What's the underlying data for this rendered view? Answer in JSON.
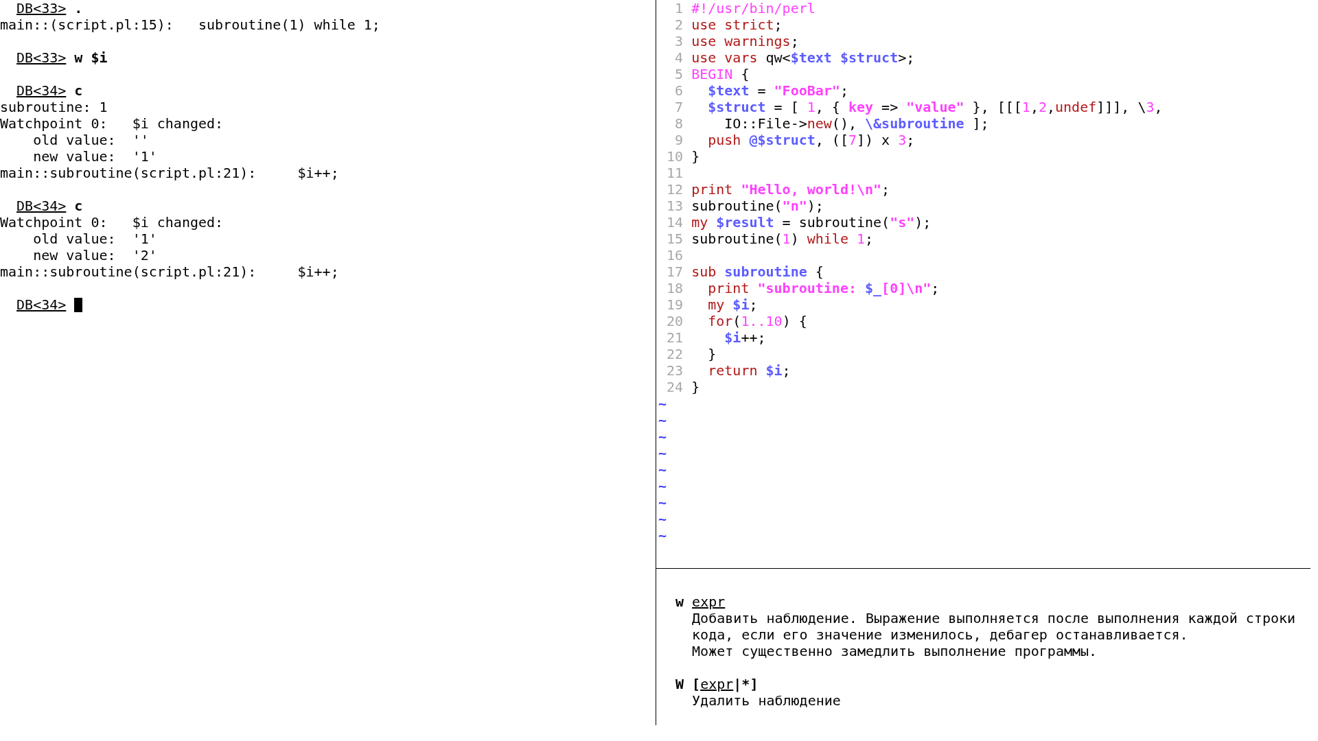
{
  "terminal": {
    "lines": [
      {
        "kind": "prompt",
        "prompt": "DB<33>",
        "command": ".",
        "cursor": false
      },
      {
        "kind": "output",
        "text": "main::(script.pl:15):   subroutine(1) while 1;"
      },
      {
        "kind": "blank"
      },
      {
        "kind": "prompt",
        "prompt": "DB<33>",
        "command": "w $i",
        "cursor": false
      },
      {
        "kind": "blank"
      },
      {
        "kind": "prompt",
        "prompt": "DB<34>",
        "command": "c",
        "cursor": false
      },
      {
        "kind": "output",
        "text": "subroutine: 1"
      },
      {
        "kind": "output",
        "text": "Watchpoint 0:   $i changed:"
      },
      {
        "kind": "output",
        "text": "    old value:  ''"
      },
      {
        "kind": "output",
        "text": "    new value:  '1'"
      },
      {
        "kind": "output",
        "text": "main::subroutine(script.pl:21):     $i++;"
      },
      {
        "kind": "blank"
      },
      {
        "kind": "prompt",
        "prompt": "DB<34>",
        "command": "c",
        "cursor": false
      },
      {
        "kind": "output",
        "text": "Watchpoint 0:   $i changed:"
      },
      {
        "kind": "output",
        "text": "    old value:  '1'"
      },
      {
        "kind": "output",
        "text": "    new value:  '2'"
      },
      {
        "kind": "output",
        "text": "main::subroutine(script.pl:21):     $i++;"
      },
      {
        "kind": "blank"
      },
      {
        "kind": "prompt",
        "prompt": "DB<34>",
        "cursor": true
      }
    ]
  },
  "editor": {
    "lines": [
      {
        "number": "1",
        "tokens": [
          {
            "kind": "pre",
            "text": "#!/usr/bin/perl"
          }
        ]
      },
      {
        "number": "2",
        "tokens": [
          {
            "kind": "stmt",
            "text": "use strict"
          },
          {
            "kind": "plain",
            "text": ";"
          }
        ]
      },
      {
        "number": "3",
        "tokens": [
          {
            "kind": "stmt",
            "text": "use warnings"
          },
          {
            "kind": "plain",
            "text": ";"
          }
        ]
      },
      {
        "number": "4",
        "tokens": [
          {
            "kind": "stmt",
            "text": "use vars "
          },
          {
            "kind": "plain",
            "text": "qw<"
          },
          {
            "kind": "var",
            "text": "$text $struct"
          },
          {
            "kind": "plain",
            "text": ">;"
          }
        ]
      },
      {
        "number": "5",
        "tokens": [
          {
            "kind": "pre",
            "text": "BEGIN"
          },
          {
            "kind": "plain",
            "text": " {"
          }
        ]
      },
      {
        "number": "6",
        "tokens": [
          {
            "kind": "var",
            "text": "  $text"
          },
          {
            "kind": "plain",
            "text": " = "
          },
          {
            "kind": "str",
            "text": "\"FooBar\""
          },
          {
            "kind": "plain",
            "text": ";"
          }
        ]
      },
      {
        "number": "7",
        "tokens": [
          {
            "kind": "var",
            "text": "  $struct"
          },
          {
            "kind": "plain",
            "text": " = [ "
          },
          {
            "kind": "num",
            "text": "1"
          },
          {
            "kind": "plain",
            "text": ", { "
          },
          {
            "kind": "str",
            "text": "key"
          },
          {
            "kind": "plain",
            "text": " => "
          },
          {
            "kind": "str",
            "text": "\"value\""
          },
          {
            "kind": "plain",
            "text": " }, [[["
          },
          {
            "kind": "num",
            "text": "1"
          },
          {
            "kind": "plain",
            "text": ","
          },
          {
            "kind": "num",
            "text": "2"
          },
          {
            "kind": "plain",
            "text": ","
          },
          {
            "kind": "stmt",
            "text": "undef"
          },
          {
            "kind": "plain",
            "text": "]]], \\"
          },
          {
            "kind": "num",
            "text": "3"
          },
          {
            "kind": "plain",
            "text": ","
          }
        ]
      },
      {
        "number": "8",
        "tokens": [
          {
            "kind": "plain",
            "text": "    IO::File->"
          },
          {
            "kind": "stmt",
            "text": "new"
          },
          {
            "kind": "plain",
            "text": "(), "
          },
          {
            "kind": "var",
            "text": "\\&subroutine"
          },
          {
            "kind": "plain",
            "text": " ];"
          }
        ]
      },
      {
        "number": "9",
        "tokens": [
          {
            "kind": "stmt",
            "text": "  push "
          },
          {
            "kind": "var",
            "text": "@$struct"
          },
          {
            "kind": "plain",
            "text": ", (["
          },
          {
            "kind": "num",
            "text": "7"
          },
          {
            "kind": "plain",
            "text": "]) x "
          },
          {
            "kind": "num",
            "text": "3"
          },
          {
            "kind": "plain",
            "text": ";"
          }
        ]
      },
      {
        "number": "10",
        "tokens": [
          {
            "kind": "plain",
            "text": "}"
          }
        ]
      },
      {
        "number": "11"
      },
      {
        "number": "12",
        "tokens": [
          {
            "kind": "stmt",
            "text": "print "
          },
          {
            "kind": "str",
            "text": "\"Hello, world!\\n\""
          },
          {
            "kind": "plain",
            "text": ";"
          }
        ]
      },
      {
        "number": "13",
        "tokens": [
          {
            "kind": "plain",
            "text": "subroutine("
          },
          {
            "kind": "str",
            "text": "\"n\""
          },
          {
            "kind": "plain",
            "text": ");"
          }
        ]
      },
      {
        "number": "14",
        "tokens": [
          {
            "kind": "stmt",
            "text": "my "
          },
          {
            "kind": "var",
            "text": "$result"
          },
          {
            "kind": "plain",
            "text": " = subroutine("
          },
          {
            "kind": "str",
            "text": "\"s\""
          },
          {
            "kind": "plain",
            "text": ");"
          }
        ]
      },
      {
        "number": "15",
        "tokens": [
          {
            "kind": "plain",
            "text": "subroutine("
          },
          {
            "kind": "num",
            "text": "1"
          },
          {
            "kind": "plain",
            "text": ") "
          },
          {
            "kind": "stmt",
            "text": "while "
          },
          {
            "kind": "num",
            "text": "1"
          },
          {
            "kind": "plain",
            "text": ";"
          }
        ]
      },
      {
        "number": "16"
      },
      {
        "number": "17",
        "tokens": [
          {
            "kind": "stmt",
            "text": "sub "
          },
          {
            "kind": "var",
            "text": "subroutine"
          },
          {
            "kind": "plain",
            "text": " {"
          }
        ]
      },
      {
        "number": "18",
        "tokens": [
          {
            "kind": "stmt",
            "text": "  print "
          },
          {
            "kind": "str",
            "text": "\"subroutine: "
          },
          {
            "kind": "var",
            "text": "$_"
          },
          {
            "kind": "str",
            "text": "[0]\\n\""
          },
          {
            "kind": "plain",
            "text": ";"
          }
        ]
      },
      {
        "number": "19",
        "tokens": [
          {
            "kind": "stmt",
            "text": "  my "
          },
          {
            "kind": "var",
            "text": "$i"
          },
          {
            "kind": "plain",
            "text": ";"
          }
        ]
      },
      {
        "number": "20",
        "tokens": [
          {
            "kind": "stmt",
            "text": "  for"
          },
          {
            "kind": "plain",
            "text": "("
          },
          {
            "kind": "num",
            "text": "1..10"
          },
          {
            "kind": "plain",
            "text": ") {"
          }
        ]
      },
      {
        "number": "21",
        "tokens": [
          {
            "kind": "var",
            "text": "    $i"
          },
          {
            "kind": "plain",
            "text": "++;"
          }
        ]
      },
      {
        "number": "22",
        "tokens": [
          {
            "kind": "plain",
            "text": "  }"
          }
        ]
      },
      {
        "number": "23",
        "tokens": [
          {
            "kind": "stmt",
            "text": "  return "
          },
          {
            "kind": "var",
            "text": "$i"
          },
          {
            "kind": "plain",
            "text": ";"
          }
        ]
      },
      {
        "number": "24",
        "tokens": [
          {
            "kind": "plain",
            "text": "}"
          }
        ]
      }
    ],
    "filler_lines": [
      "~",
      "~",
      "~",
      "~",
      "~",
      "~",
      "~",
      "~",
      "~"
    ]
  },
  "help": {
    "entries": [
      {
        "signature": [
          {
            "text": "w ",
            "underline": false
          },
          {
            "text": "expr",
            "underline": true
          }
        ],
        "description": [
          "Добавить наблюдение. Выражение выполняется после выполнения каждой строки",
          "кода, если его значение изменилось, дебагер останавливается.",
          "Может существенно замедлить выполнение программы."
        ]
      },
      {
        "signature": [
          {
            "text": "W [",
            "underline": false
          },
          {
            "text": "expr",
            "underline": true
          },
          {
            "text": "|*]",
            "underline": false
          }
        ],
        "description": [
          "Удалить наблюдение"
        ]
      }
    ]
  }
}
